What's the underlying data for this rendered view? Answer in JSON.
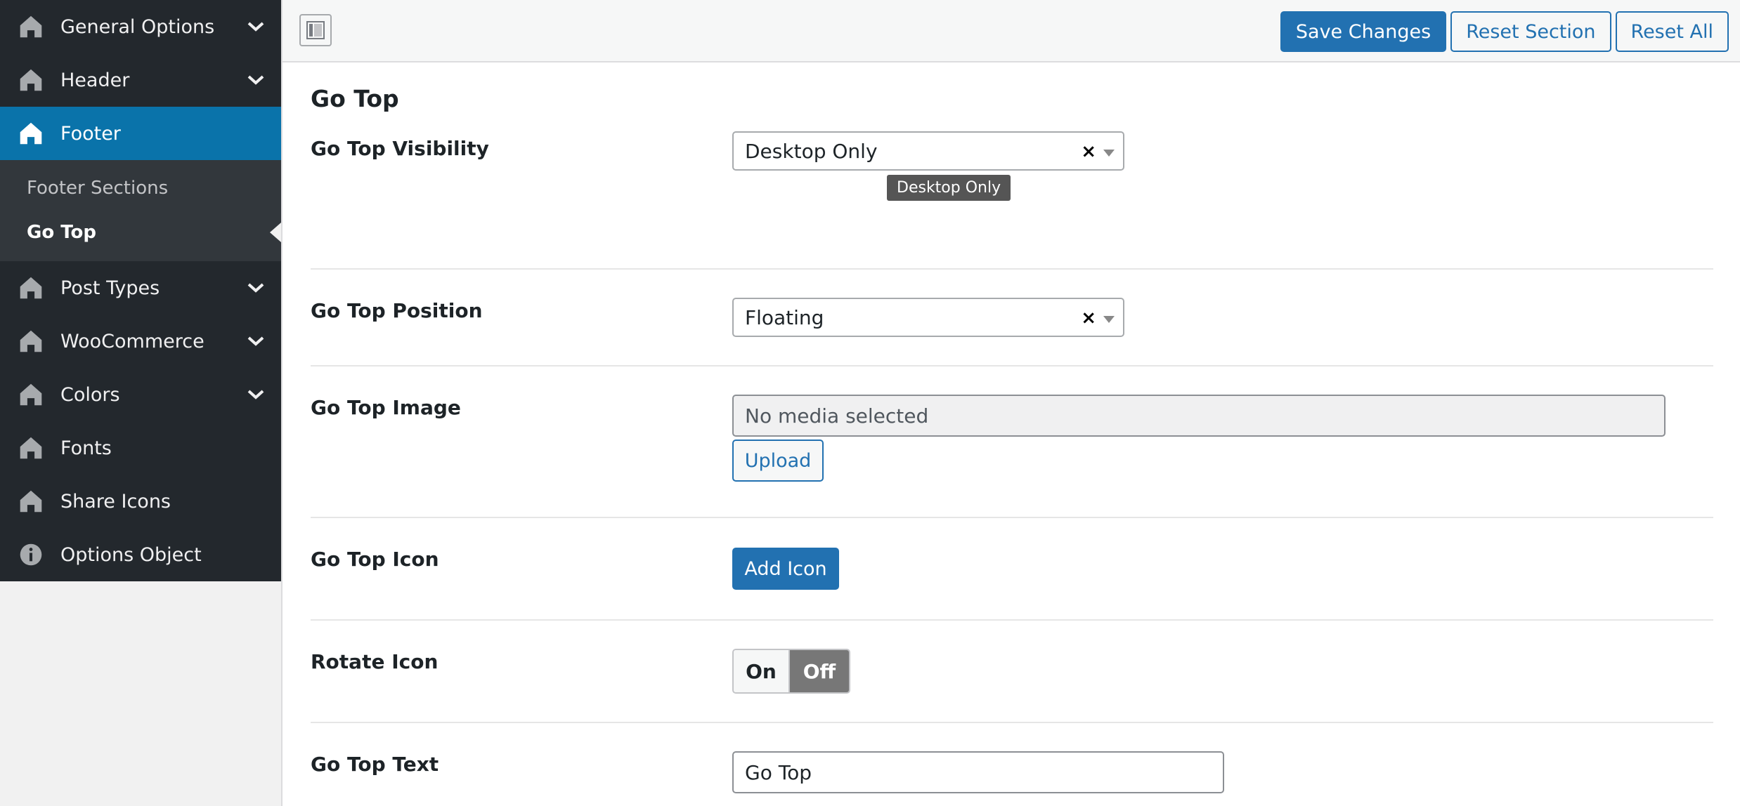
{
  "sidebar": {
    "items": [
      {
        "label": "General Options",
        "icon": "home-icon",
        "has_children": true
      },
      {
        "label": "Header",
        "icon": "home-icon",
        "has_children": true
      },
      {
        "label": "Footer",
        "icon": "home-icon",
        "active": true
      },
      {
        "label": "Post Types",
        "icon": "home-icon",
        "has_children": true
      },
      {
        "label": "WooCommerce",
        "icon": "home-icon",
        "has_children": true
      },
      {
        "label": "Colors",
        "icon": "home-icon",
        "has_children": true
      },
      {
        "label": "Fonts",
        "icon": "home-icon"
      },
      {
        "label": "Share Icons",
        "icon": "home-icon"
      },
      {
        "label": "Options Object",
        "icon": "info-icon"
      }
    ],
    "footer_submenu": [
      {
        "label": "Footer Sections"
      },
      {
        "label": "Go Top",
        "current": true
      }
    ]
  },
  "toolbar": {
    "save_label": "Save Changes",
    "reset_section_label": "Reset Section",
    "reset_all_label": "Reset All"
  },
  "section": {
    "title": "Go Top",
    "fields": {
      "visibility": {
        "label": "Go Top Visibility",
        "value": "Desktop Only",
        "tooltip": "Desktop Only"
      },
      "position": {
        "label": "Go Top Position",
        "value": "Floating"
      },
      "image": {
        "label": "Go Top Image",
        "value": "No media selected",
        "upload_label": "Upload"
      },
      "icon": {
        "label": "Go Top Icon",
        "button_label": "Add Icon"
      },
      "rotate": {
        "label": "Rotate Icon",
        "on_label": "On",
        "off_label": "Off",
        "selected": "Off"
      },
      "text": {
        "label": "Go Top Text",
        "value": "Go Top"
      }
    }
  },
  "colors": {
    "sidebar_bg": "#23282d",
    "submenu_bg": "#32373c",
    "active_bg": "#0a73aa",
    "primary": "#2271b1"
  }
}
